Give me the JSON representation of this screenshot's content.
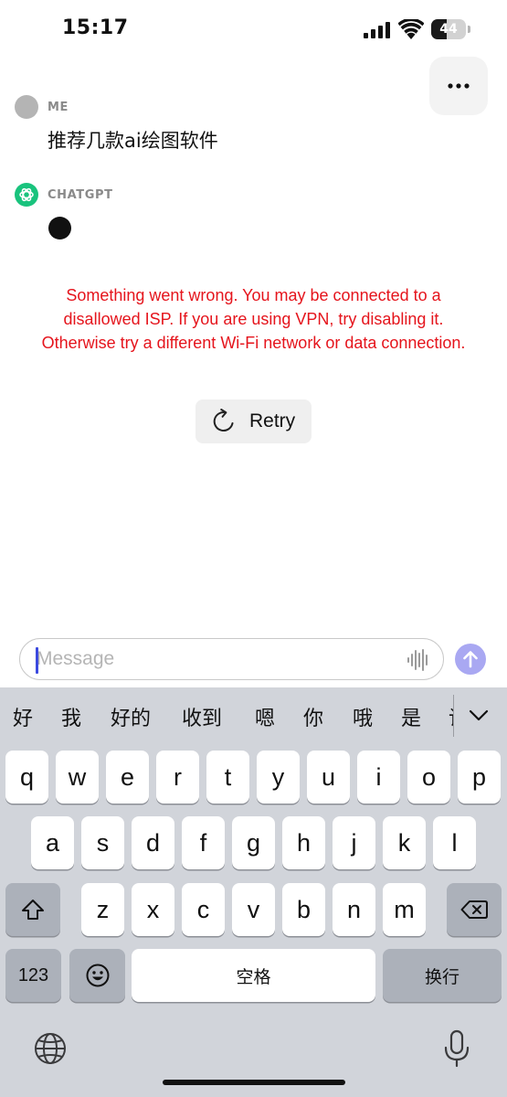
{
  "status_bar": {
    "time": "15:17",
    "battery_level": "44",
    "battery_fraction": 0.44
  },
  "header": {
    "more_icon": "ellipsis-icon"
  },
  "conversation": {
    "user": {
      "sender": "ME",
      "text": "推荐几款ai绘图软件"
    },
    "assistant": {
      "sender": "CHATGPT",
      "avatar_icon": "openai-logo-icon",
      "state": "typing-dot"
    }
  },
  "error": {
    "message": "Something went wrong. You may be connected to a disallowed ISP. If you are using VPN, try disabling it. Otherwise try a different Wi-Fi network or data connection.",
    "retry_label": "Retry",
    "color": "#e5141c"
  },
  "composer": {
    "placeholder": "Message",
    "value": "",
    "voice_icon": "waveform-icon",
    "send_icon": "arrow-up-icon",
    "send_color": "#a9a8f2"
  },
  "keyboard": {
    "candidates": [
      "好",
      "我",
      "好的",
      "收到",
      "嗯",
      "你",
      "哦",
      "是",
      "请"
    ],
    "row1": [
      "q",
      "w",
      "e",
      "r",
      "t",
      "y",
      "u",
      "i",
      "o",
      "p"
    ],
    "row2": [
      "a",
      "s",
      "d",
      "f",
      "g",
      "h",
      "j",
      "k",
      "l"
    ],
    "row3": [
      "z",
      "x",
      "c",
      "v",
      "b",
      "n",
      "m"
    ],
    "numbers_key": "123",
    "space_key": "空格",
    "return_key": "换行"
  }
}
